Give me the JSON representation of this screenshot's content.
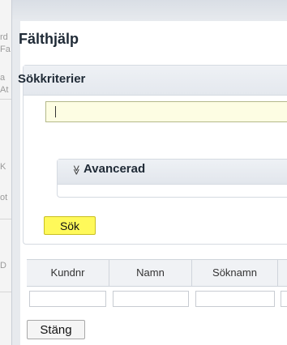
{
  "background_fragments": [
    "rd",
    "Fa",
    "a",
    "At",
    "K",
    "ot",
    "D"
  ],
  "dialog": {
    "title": "Fälthjälp",
    "search_panel": {
      "title": "Sökkriterier",
      "input_value": "",
      "advanced": {
        "icon": "double-chevron-down-icon",
        "glyph": "≫",
        "label": "Avancerad"
      },
      "search_button": "Sök",
      "search_button_color": "#fff95a"
    },
    "results": {
      "columns": [
        "Kundnr",
        "Namn",
        "Söknamn"
      ]
    },
    "close_button": "Stäng"
  }
}
